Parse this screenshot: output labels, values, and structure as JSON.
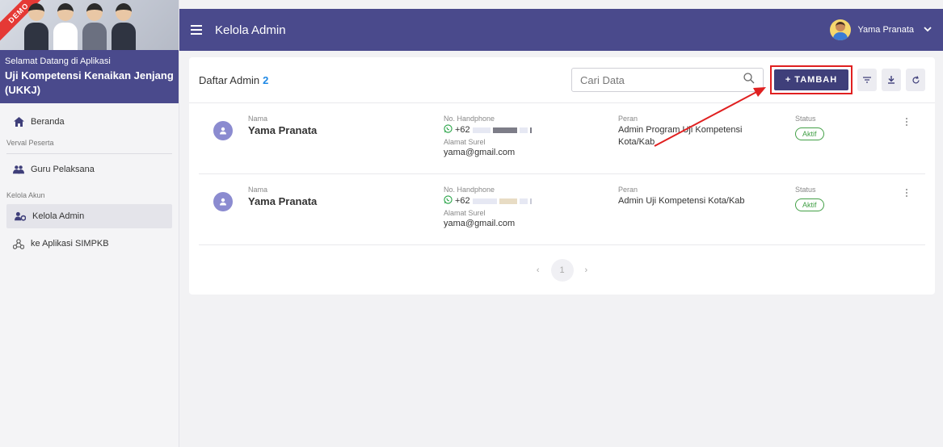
{
  "sidebar": {
    "demo_label": "DEMO",
    "welcome_sub": "Selamat Datang di Aplikasi",
    "welcome_title": "Uji Kompetensi Kenaikan Jenjang (UKKJ)",
    "items": [
      {
        "label": "Beranda",
        "icon": "home-icon"
      },
      {
        "section": "Verval Peserta"
      },
      {
        "label": "Guru Pelaksana",
        "icon": "people-icon"
      },
      {
        "section": "Kelola Akun"
      },
      {
        "label": "Kelola Admin",
        "icon": "user-gear-icon",
        "active": true
      },
      {
        "label": "ke Aplikasi SIMPKB",
        "icon": "webhook-icon"
      }
    ]
  },
  "header": {
    "title": "Kelola Admin",
    "user_name": "Yama Pranata"
  },
  "list": {
    "title": "Daftar Admin",
    "count": "2",
    "search_placeholder": "Cari Data",
    "add_label": "+ TAMBAH",
    "labels": {
      "name": "Nama",
      "phone": "No. Handphone",
      "email": "Alamat Surel",
      "role": "Peran",
      "status": "Status"
    },
    "rows": [
      {
        "name": "Yama Pranata",
        "phone_prefix": "+62",
        "email": "yama@gmail.com",
        "role": "Admin Program Uji Kompetensi Kota/Kab",
        "status": "Aktif"
      },
      {
        "name": "Yama Pranata",
        "phone_prefix": "+62",
        "email": "yama@gmail.com",
        "role": "Admin Uji Kompetensi Kota/Kab",
        "status": "Aktif"
      }
    ],
    "pagination": {
      "prev": "‹",
      "current": "1",
      "next": "›"
    }
  },
  "colors": {
    "primary": "#4a4a8c",
    "button": "#3f3f7a",
    "highlight": "#e02020",
    "active_status": "#43a047",
    "count": "#1e88e5"
  }
}
